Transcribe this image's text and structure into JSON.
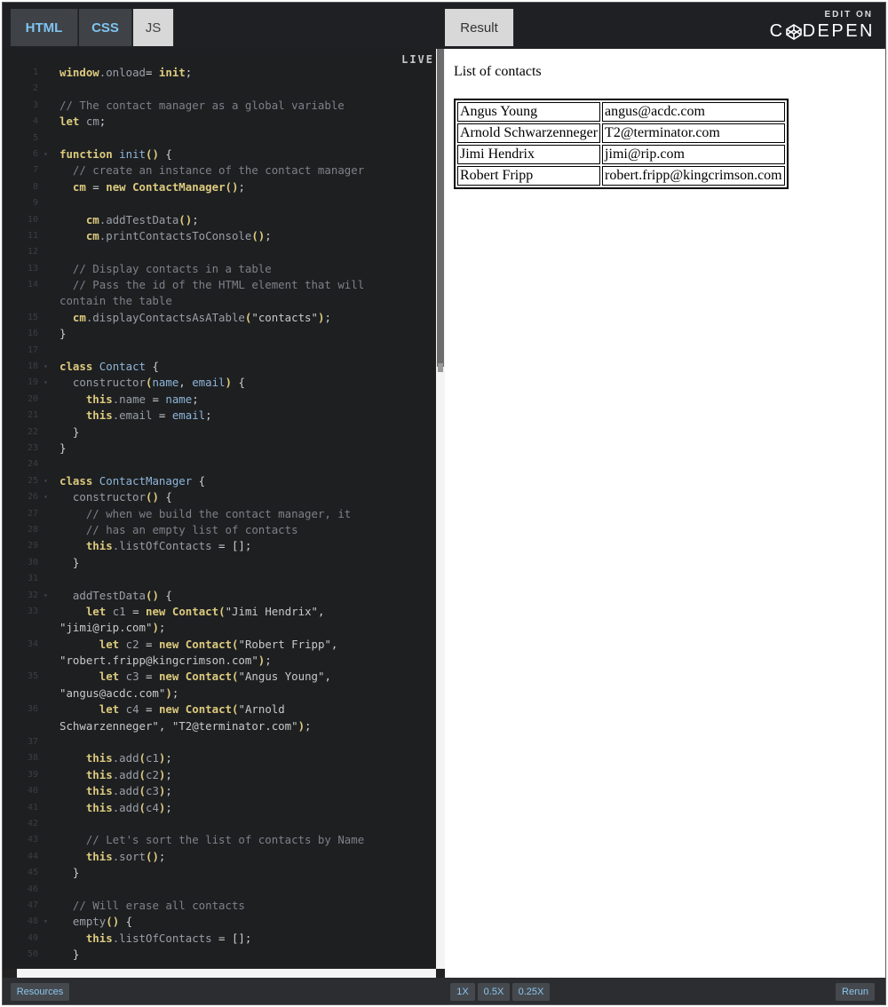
{
  "tabs": {
    "html": "HTML",
    "css": "CSS",
    "js": "JS",
    "result": "Result"
  },
  "brand": {
    "edit_on": "EDIT ON",
    "name_left": "C",
    "name_right": "DEPEN"
  },
  "editor": {
    "live_label": "LIVE",
    "lines": [
      {
        "n": "1",
        "fold": false,
        "parts": [
          [
            "kw",
            "window"
          ],
          [
            "prop",
            ".onload"
          ],
          [
            "txt",
            "= "
          ],
          [
            "kw",
            "init"
          ],
          [
            "txt",
            ";"
          ]
        ]
      },
      {
        "n": "2",
        "fold": false,
        "parts": []
      },
      {
        "n": "3",
        "fold": false,
        "parts": [
          [
            "cm",
            "// The contact manager as a global variable"
          ]
        ]
      },
      {
        "n": "4",
        "fold": false,
        "parts": [
          [
            "kw",
            "let"
          ],
          [
            "txt",
            " "
          ],
          [
            "prop",
            "cm"
          ],
          [
            "txt",
            ";"
          ]
        ]
      },
      {
        "n": "5",
        "fold": false,
        "parts": []
      },
      {
        "n": "6",
        "fold": true,
        "parts": [
          [
            "kw",
            "function"
          ],
          [
            "txt",
            " "
          ],
          [
            "var",
            "init"
          ],
          [
            "fn",
            "()"
          ],
          [
            "txt",
            " {"
          ]
        ]
      },
      {
        "n": "7",
        "fold": false,
        "parts": [
          [
            "txt",
            "  "
          ],
          [
            "cm",
            "// create an instance of the contact manager"
          ]
        ]
      },
      {
        "n": "8",
        "fold": false,
        "parts": [
          [
            "txt",
            "  "
          ],
          [
            "kw",
            "cm"
          ],
          [
            "txt",
            " = "
          ],
          [
            "kw",
            "new"
          ],
          [
            "txt",
            " "
          ],
          [
            "fn",
            "ContactManager()"
          ],
          [
            "txt",
            ";"
          ]
        ]
      },
      {
        "n": "9",
        "fold": false,
        "parts": []
      },
      {
        "n": "10",
        "fold": false,
        "parts": [
          [
            "txt",
            "    "
          ],
          [
            "kw",
            "cm"
          ],
          [
            "prop",
            ".addTestData"
          ],
          [
            "fn",
            "()"
          ],
          [
            "txt",
            ";"
          ]
        ]
      },
      {
        "n": "11",
        "fold": false,
        "parts": [
          [
            "txt",
            "    "
          ],
          [
            "kw",
            "cm"
          ],
          [
            "prop",
            ".printContactsToConsole"
          ],
          [
            "fn",
            "()"
          ],
          [
            "txt",
            ";"
          ]
        ]
      },
      {
        "n": "12",
        "fold": false,
        "parts": []
      },
      {
        "n": "13",
        "fold": false,
        "parts": [
          [
            "txt",
            "  "
          ],
          [
            "cm",
            "// Display contacts in a table"
          ]
        ]
      },
      {
        "n": "14",
        "fold": false,
        "parts": [
          [
            "txt",
            "  "
          ],
          [
            "cm",
            "// Pass the id of the HTML element that will"
          ]
        ]
      },
      {
        "n": "",
        "fold": false,
        "parts": [
          [
            "cm",
            "contain the table"
          ]
        ]
      },
      {
        "n": "15",
        "fold": false,
        "parts": [
          [
            "txt",
            "  "
          ],
          [
            "kw",
            "cm"
          ],
          [
            "prop",
            ".displayContactsAsATable"
          ],
          [
            "fn",
            "("
          ],
          [
            "str",
            "\"contacts\""
          ],
          [
            "fn",
            ")"
          ],
          [
            "txt",
            ";"
          ]
        ]
      },
      {
        "n": "16",
        "fold": false,
        "parts": [
          [
            "txt",
            "}"
          ]
        ]
      },
      {
        "n": "17",
        "fold": false,
        "parts": []
      },
      {
        "n": "18",
        "fold": true,
        "parts": [
          [
            "kw",
            "class"
          ],
          [
            "txt",
            " "
          ],
          [
            "var",
            "Contact"
          ],
          [
            "txt",
            " {"
          ]
        ]
      },
      {
        "n": "19",
        "fold": true,
        "parts": [
          [
            "txt",
            "  "
          ],
          [
            "prop",
            "constructor"
          ],
          [
            "fn",
            "("
          ],
          [
            "var",
            "name"
          ],
          [
            "txt",
            ", "
          ],
          [
            "var",
            "email"
          ],
          [
            "fn",
            ")"
          ],
          [
            "txt",
            " {"
          ]
        ]
      },
      {
        "n": "20",
        "fold": false,
        "parts": [
          [
            "txt",
            "    "
          ],
          [
            "kw",
            "this"
          ],
          [
            "prop",
            ".name"
          ],
          [
            "txt",
            " = "
          ],
          [
            "var",
            "name"
          ],
          [
            "txt",
            ";"
          ]
        ]
      },
      {
        "n": "21",
        "fold": false,
        "parts": [
          [
            "txt",
            "    "
          ],
          [
            "kw",
            "this"
          ],
          [
            "prop",
            ".email"
          ],
          [
            "txt",
            " = "
          ],
          [
            "var",
            "email"
          ],
          [
            "txt",
            ";"
          ]
        ]
      },
      {
        "n": "22",
        "fold": false,
        "parts": [
          [
            "txt",
            "  }"
          ]
        ]
      },
      {
        "n": "23",
        "fold": false,
        "parts": [
          [
            "txt",
            "}"
          ]
        ]
      },
      {
        "n": "24",
        "fold": false,
        "parts": []
      },
      {
        "n": "25",
        "fold": true,
        "parts": [
          [
            "kw",
            "class"
          ],
          [
            "txt",
            " "
          ],
          [
            "var",
            "ContactManager"
          ],
          [
            "txt",
            " {"
          ]
        ]
      },
      {
        "n": "26",
        "fold": true,
        "parts": [
          [
            "txt",
            "  "
          ],
          [
            "prop",
            "constructor"
          ],
          [
            "fn",
            "()"
          ],
          [
            "txt",
            " {"
          ]
        ]
      },
      {
        "n": "27",
        "fold": false,
        "parts": [
          [
            "txt",
            "    "
          ],
          [
            "cm",
            "// when we build the contact manager, it"
          ]
        ]
      },
      {
        "n": "28",
        "fold": false,
        "parts": [
          [
            "txt",
            "    "
          ],
          [
            "cm",
            "// has an empty list of contacts"
          ]
        ]
      },
      {
        "n": "29",
        "fold": false,
        "parts": [
          [
            "txt",
            "    "
          ],
          [
            "kw",
            "this"
          ],
          [
            "prop",
            ".listOfContacts"
          ],
          [
            "txt",
            " = [];"
          ]
        ]
      },
      {
        "n": "30",
        "fold": false,
        "parts": [
          [
            "txt",
            "  }"
          ]
        ]
      },
      {
        "n": "31",
        "fold": false,
        "parts": []
      },
      {
        "n": "32",
        "fold": true,
        "parts": [
          [
            "txt",
            "  "
          ],
          [
            "prop",
            "addTestData"
          ],
          [
            "fn",
            "()"
          ],
          [
            "txt",
            " {"
          ]
        ]
      },
      {
        "n": "33",
        "fold": false,
        "parts": [
          [
            "txt",
            "    "
          ],
          [
            "kw",
            "let"
          ],
          [
            "txt",
            " "
          ],
          [
            "prop",
            "c1"
          ],
          [
            "txt",
            " = "
          ],
          [
            "kw",
            "new"
          ],
          [
            "txt",
            " "
          ],
          [
            "fn",
            "Contact("
          ],
          [
            "str",
            "\"Jimi Hendrix\""
          ],
          [
            "txt",
            ","
          ]
        ]
      },
      {
        "n": "",
        "fold": false,
        "parts": [
          [
            "str",
            "\"jimi@rip.com\""
          ],
          [
            "fn",
            ")"
          ],
          [
            "txt",
            ";"
          ]
        ]
      },
      {
        "n": "34",
        "fold": false,
        "parts": [
          [
            "txt",
            "      "
          ],
          [
            "kw",
            "let"
          ],
          [
            "txt",
            " "
          ],
          [
            "prop",
            "c2"
          ],
          [
            "txt",
            " = "
          ],
          [
            "kw",
            "new"
          ],
          [
            "txt",
            " "
          ],
          [
            "fn",
            "Contact("
          ],
          [
            "str",
            "\"Robert Fripp\""
          ],
          [
            "txt",
            ","
          ]
        ]
      },
      {
        "n": "",
        "fold": false,
        "parts": [
          [
            "str",
            "\"robert.fripp@kingcrimson.com\""
          ],
          [
            "fn",
            ")"
          ],
          [
            "txt",
            ";"
          ]
        ]
      },
      {
        "n": "35",
        "fold": false,
        "parts": [
          [
            "txt",
            "      "
          ],
          [
            "kw",
            "let"
          ],
          [
            "txt",
            " "
          ],
          [
            "prop",
            "c3"
          ],
          [
            "txt",
            " = "
          ],
          [
            "kw",
            "new"
          ],
          [
            "txt",
            " "
          ],
          [
            "fn",
            "Contact("
          ],
          [
            "str",
            "\"Angus Young\""
          ],
          [
            "txt",
            ","
          ]
        ]
      },
      {
        "n": "",
        "fold": false,
        "parts": [
          [
            "str",
            "\"angus@acdc.com\""
          ],
          [
            "fn",
            ")"
          ],
          [
            "txt",
            ";"
          ]
        ]
      },
      {
        "n": "36",
        "fold": false,
        "parts": [
          [
            "txt",
            "      "
          ],
          [
            "kw",
            "let"
          ],
          [
            "txt",
            " "
          ],
          [
            "prop",
            "c4"
          ],
          [
            "txt",
            " = "
          ],
          [
            "kw",
            "new"
          ],
          [
            "txt",
            " "
          ],
          [
            "fn",
            "Contact("
          ],
          [
            "str",
            "\"Arnold"
          ]
        ]
      },
      {
        "n": "",
        "fold": false,
        "parts": [
          [
            "str",
            "Schwarzenneger\""
          ],
          [
            "txt",
            ", "
          ],
          [
            "str",
            "\"T2@terminator.com\""
          ],
          [
            "fn",
            ")"
          ],
          [
            "txt",
            ";"
          ]
        ]
      },
      {
        "n": "37",
        "fold": false,
        "parts": []
      },
      {
        "n": "38",
        "fold": false,
        "parts": [
          [
            "txt",
            "    "
          ],
          [
            "kw",
            "this"
          ],
          [
            "prop",
            ".add"
          ],
          [
            "fn",
            "("
          ],
          [
            "prop",
            "c1"
          ],
          [
            "fn",
            ")"
          ],
          [
            "txt",
            ";"
          ]
        ]
      },
      {
        "n": "39",
        "fold": false,
        "parts": [
          [
            "txt",
            "    "
          ],
          [
            "kw",
            "this"
          ],
          [
            "prop",
            ".add"
          ],
          [
            "fn",
            "("
          ],
          [
            "prop",
            "c2"
          ],
          [
            "fn",
            ")"
          ],
          [
            "txt",
            ";"
          ]
        ]
      },
      {
        "n": "40",
        "fold": false,
        "parts": [
          [
            "txt",
            "    "
          ],
          [
            "kw",
            "this"
          ],
          [
            "prop",
            ".add"
          ],
          [
            "fn",
            "("
          ],
          [
            "prop",
            "c3"
          ],
          [
            "fn",
            ")"
          ],
          [
            "txt",
            ";"
          ]
        ]
      },
      {
        "n": "41",
        "fold": false,
        "parts": [
          [
            "txt",
            "    "
          ],
          [
            "kw",
            "this"
          ],
          [
            "prop",
            ".add"
          ],
          [
            "fn",
            "("
          ],
          [
            "prop",
            "c4"
          ],
          [
            "fn",
            ")"
          ],
          [
            "txt",
            ";"
          ]
        ]
      },
      {
        "n": "42",
        "fold": false,
        "parts": []
      },
      {
        "n": "43",
        "fold": false,
        "parts": [
          [
            "txt",
            "    "
          ],
          [
            "cm",
            "// Let's sort the list of contacts by Name"
          ]
        ]
      },
      {
        "n": "44",
        "fold": false,
        "parts": [
          [
            "txt",
            "    "
          ],
          [
            "kw",
            "this"
          ],
          [
            "prop",
            ".sort"
          ],
          [
            "fn",
            "()"
          ],
          [
            "txt",
            ";"
          ]
        ]
      },
      {
        "n": "45",
        "fold": false,
        "parts": [
          [
            "txt",
            "  }"
          ]
        ]
      },
      {
        "n": "46",
        "fold": false,
        "parts": []
      },
      {
        "n": "47",
        "fold": false,
        "parts": [
          [
            "txt",
            "  "
          ],
          [
            "cm",
            "// Will erase all contacts"
          ]
        ]
      },
      {
        "n": "48",
        "fold": true,
        "parts": [
          [
            "txt",
            "  "
          ],
          [
            "prop",
            "empty"
          ],
          [
            "fn",
            "()"
          ],
          [
            "txt",
            " {"
          ]
        ]
      },
      {
        "n": "49",
        "fold": false,
        "parts": [
          [
            "txt",
            "    "
          ],
          [
            "kw",
            "this"
          ],
          [
            "prop",
            ".listOfContacts"
          ],
          [
            "txt",
            " = [];"
          ]
        ]
      },
      {
        "n": "50",
        "fold": false,
        "parts": [
          [
            "txt",
            "  }"
          ]
        ]
      }
    ]
  },
  "result": {
    "title": "List of contacts",
    "contacts": [
      {
        "name": "Angus Young",
        "email": "angus@acdc.com"
      },
      {
        "name": "Arnold Schwarzenneger",
        "email": "T2@terminator.com"
      },
      {
        "name": "Jimi Hendrix",
        "email": "jimi@rip.com"
      },
      {
        "name": "Robert Fripp",
        "email": "robert.fripp@kingcrimson.com"
      }
    ]
  },
  "footer": {
    "resources": "Resources",
    "zoom_1x": "1X",
    "zoom_05x": "0.5X",
    "zoom_025x": "0.25X",
    "rerun": "Rerun"
  },
  "colors": {
    "tab_text": "#7fc3f0",
    "editor_bg": "#1d1f21",
    "keyword": "#ddca7e",
    "comment": "#7d8189"
  },
  "icons": {
    "brand_logo": "codepen-cube-icon",
    "fold": "fold-arrow-icon"
  }
}
